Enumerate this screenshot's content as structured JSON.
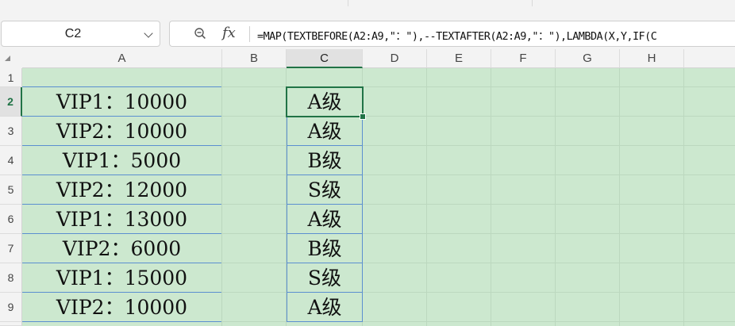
{
  "name_box": {
    "value": "C2"
  },
  "formula_bar": {
    "formula": "=MAP(TEXTBEFORE(A2:A9,\"：\"),--TEXTAFTER(A2:A9,\"：\"),LAMBDA(X,Y,IF(C"
  },
  "columns": [
    "A",
    "B",
    "C",
    "D",
    "E",
    "F",
    "G",
    "H"
  ],
  "rows": [
    "1",
    "2",
    "3",
    "4",
    "5",
    "6",
    "7",
    "8",
    "9"
  ],
  "selected_column": "C",
  "selected_row": "2",
  "column_a": [
    "VIP1：10000",
    "VIP2：10000",
    "VIP1：5000",
    "VIP2：12000",
    "VIP1：13000",
    "VIP2：6000",
    "VIP1：15000",
    "VIP2：10000"
  ],
  "column_c": [
    "A级",
    "A级",
    "B级",
    "S级",
    "A级",
    "B级",
    "S级",
    "A级"
  ],
  "colors": {
    "sheet_fill": "#cce8cf",
    "selection": "#217346",
    "cell_border": "#5b8fd0"
  }
}
